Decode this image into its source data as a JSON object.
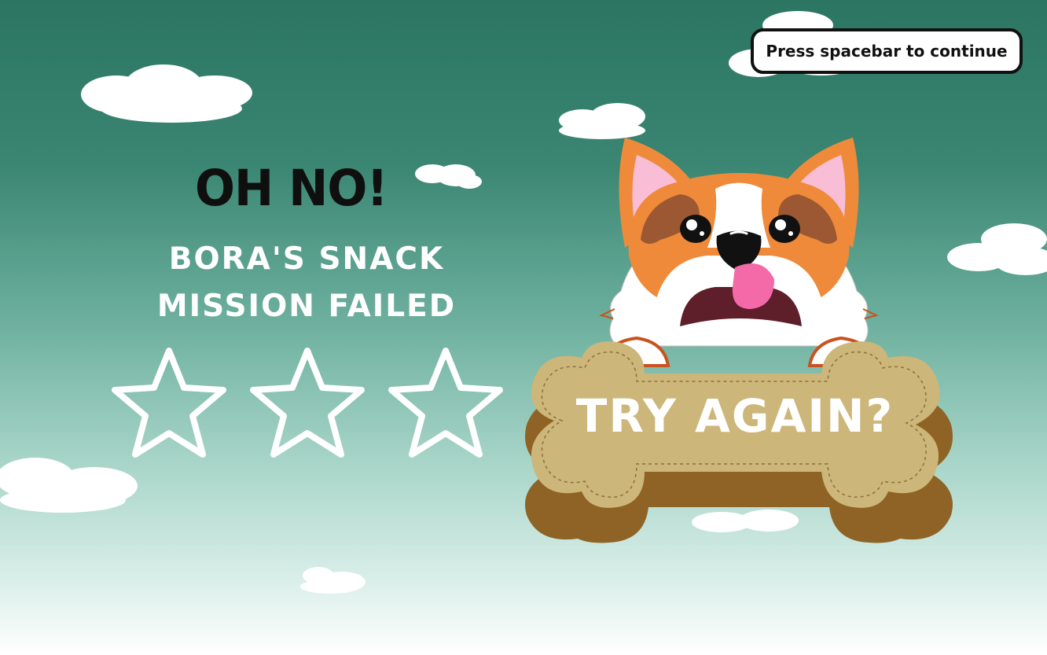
{
  "game": {
    "result_title": "OH NO!",
    "result_subtitle": "BORA'S SNACK MISSION FAILED",
    "stars_earned": 0,
    "stars_total": 3,
    "continue_prompt": "Press spacebar to continue",
    "retry_label": "TRY AGAIN?"
  },
  "colors": {
    "sky_top": "#2b7562",
    "sky_bottom": "#ffffff",
    "bone_light": "#cdb679",
    "bone_dark": "#8e6325",
    "corgi_orange": "#ef8a3a",
    "corgi_brown": "#9b5832",
    "tongue_pink": "#f46aa8"
  }
}
